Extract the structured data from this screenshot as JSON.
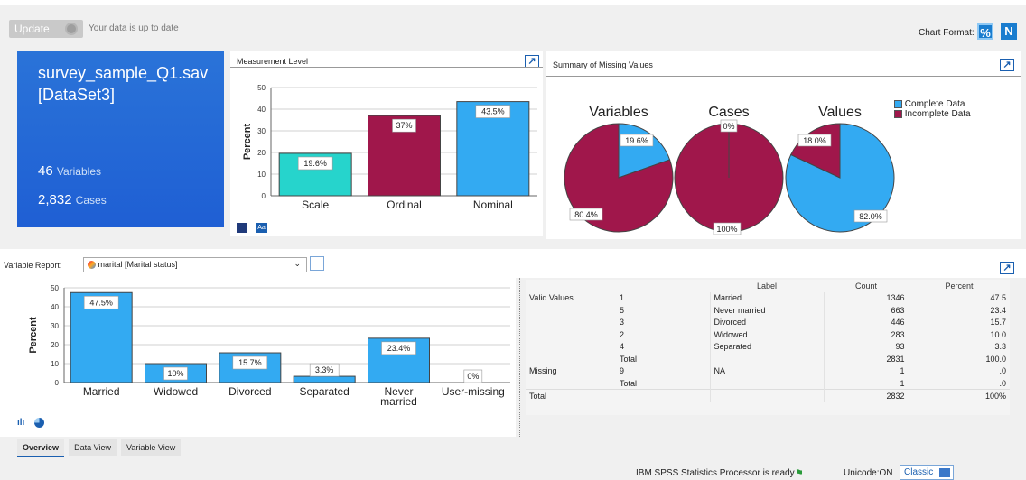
{
  "toolbar": {
    "update_label": "Update",
    "update_status": "Your data is up to date",
    "chart_format_label": "Chart Format:",
    "format_percent": "%",
    "format_count": "N"
  },
  "dataset": {
    "file_name": "survey_sample_Q1.sav",
    "dataset_name": "[DataSet3]",
    "variables_count": "46",
    "variables_label": "Variables",
    "cases_count": "2,832",
    "cases_label": "Cases"
  },
  "measurement": {
    "title": "Measurement Level",
    "ylabel": "Percent"
  },
  "missing": {
    "title": "Summary of Missing Values",
    "pie_titles": [
      "Variables",
      "Cases",
      "Values"
    ]
  },
  "variable_report": {
    "label": "Variable Report:",
    "selected": "marital  [Marital status]"
  },
  "freq_table": {
    "headers": [
      "Label",
      "Count",
      "Percent"
    ],
    "rows": [
      [
        "Valid Values",
        "1",
        "Married",
        "1346",
        "47.5"
      ],
      [
        "",
        "5",
        "Never married",
        "663",
        "23.4"
      ],
      [
        "",
        "3",
        "Divorced",
        "446",
        "15.7"
      ],
      [
        "",
        "2",
        "Widowed",
        "283",
        "10.0"
      ],
      [
        "",
        "4",
        "Separated",
        "93",
        "3.3"
      ],
      [
        "",
        "Total",
        "",
        "2831",
        "100.0"
      ],
      [
        "Missing",
        "9",
        "NA",
        "1",
        ".0"
      ],
      [
        "",
        "Total",
        "",
        "1",
        ".0"
      ],
      [
        "Total",
        "",
        "",
        "2832",
        "100%"
      ]
    ]
  },
  "tabs": [
    "Overview",
    "Data View",
    "Variable View"
  ],
  "status": {
    "processor": "IBM SPSS Statistics Processor is ready",
    "unicode": "Unicode:ON",
    "mode": "Classic"
  },
  "colors": {
    "blue": "#33aaf2",
    "teal": "#26d4cc",
    "maroon": "#a0174b"
  },
  "chart_data": [
    {
      "type": "bar",
      "categories": [
        "Scale",
        "Ordinal",
        "Nominal"
      ],
      "values": [
        19.6,
        37,
        43.5
      ],
      "value_labels": [
        "19.6%",
        "37%",
        "43.5%"
      ],
      "colors": [
        "#26d4cc",
        "#a0174b",
        "#33aaf2"
      ],
      "ylabel": "Percent",
      "ylim": [
        0,
        50
      ],
      "yticks": [
        0,
        10,
        20,
        30,
        40,
        50
      ]
    },
    {
      "type": "pie",
      "title": "Variables",
      "legend": [
        "Complete Data",
        "Incomplete Data"
      ],
      "values": [
        19.6,
        80.4
      ],
      "value_labels": [
        "19.6%",
        "80.4%"
      ],
      "colors": [
        "#33aaf2",
        "#a0174b"
      ]
    },
    {
      "type": "pie",
      "title": "Cases",
      "values": [
        0,
        100
      ],
      "value_labels": [
        "0%",
        "100%"
      ],
      "colors": [
        "#33aaf2",
        "#a0174b"
      ]
    },
    {
      "type": "pie",
      "title": "Values",
      "values": [
        82.0,
        18.0
      ],
      "value_labels": [
        "82.0%",
        "18.0%"
      ],
      "colors": [
        "#33aaf2",
        "#a0174b"
      ]
    },
    {
      "type": "bar",
      "categories": [
        "Married",
        "Widowed",
        "Divorced",
        "Separated",
        "Never married",
        "User-missing"
      ],
      "values": [
        47.5,
        10,
        15.7,
        3.3,
        23.4,
        0
      ],
      "value_labels": [
        "47.5%",
        "10%",
        "15.7%",
        "3.3%",
        "23.4%",
        "0%"
      ],
      "ylabel": "Percent",
      "ylim": [
        0,
        50
      ],
      "yticks": [
        0,
        10,
        20,
        30,
        40,
        50
      ]
    }
  ]
}
